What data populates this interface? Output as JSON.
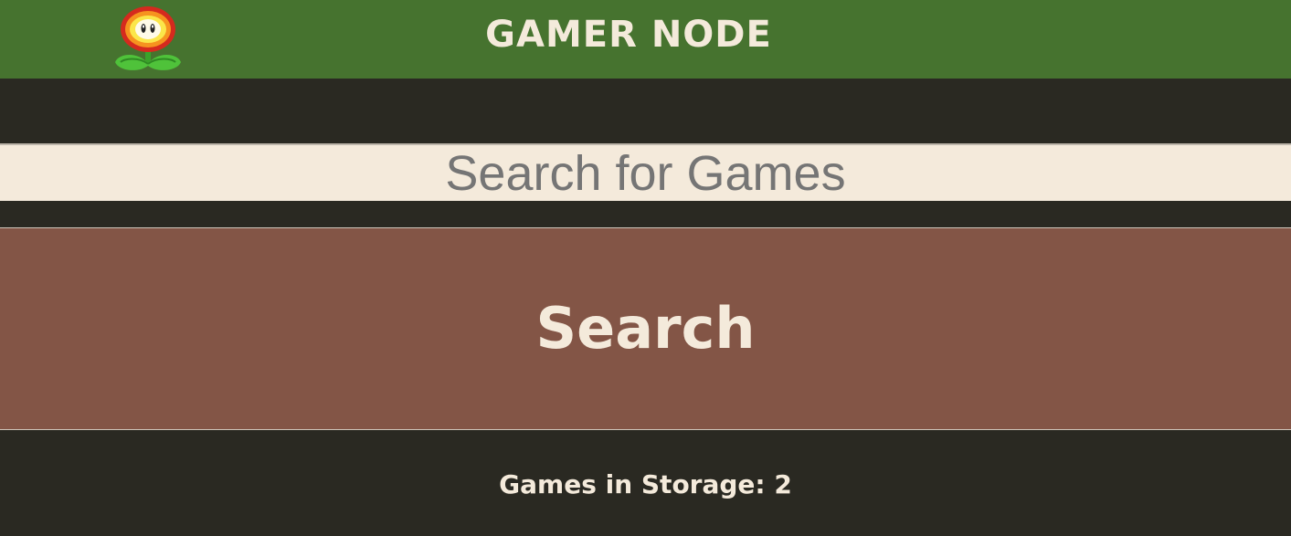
{
  "header": {
    "title": "GAMER NODE",
    "logo_icon": "fire-flower-icon",
    "background_color": "#46732f"
  },
  "search": {
    "placeholder": "Search for Games",
    "value": "",
    "button_label": "Search",
    "button_color": "#835546"
  },
  "storage": {
    "label": "Games in Storage: 2",
    "count": 2
  },
  "colors": {
    "page_background": "#2a2922",
    "text_light": "#f4eadb",
    "input_background": "#f4eadb"
  }
}
